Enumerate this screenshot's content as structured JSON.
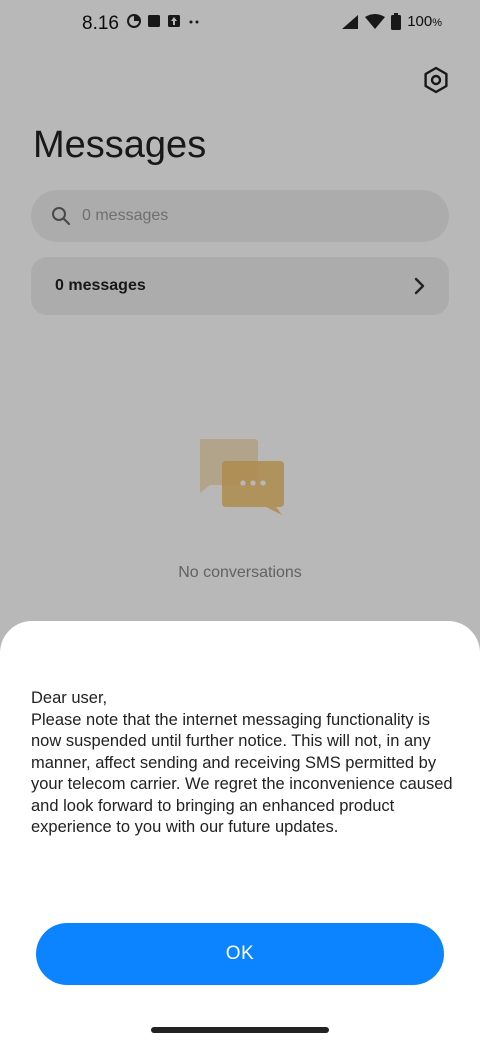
{
  "status_bar": {
    "time": "8.16",
    "battery": "100",
    "battery_unit": "%"
  },
  "app": {
    "title": "Messages",
    "search": {
      "placeholder": "0 messages"
    },
    "messages_row": {
      "label": "0 messages"
    },
    "empty_state": {
      "text": "No conversations"
    }
  },
  "dialog": {
    "message": "Dear user,\nPlease note that the internet messaging functionality is now suspended until further notice. This will not, in any manner, affect sending and receiving SMS permitted by your telecom carrier. We regret the inconvenience caused and look forward to bringing an enhanced product experience to you with our future updates.",
    "ok_label": "OK"
  },
  "colors": {
    "primary": "#0d84ff",
    "illustration": "#f2c26b"
  },
  "icons": [
    "settings-icon",
    "search-icon",
    "chevron-right-icon",
    "chat-bubbles-icon",
    "signal-icon",
    "wifi-icon",
    "battery-icon"
  ]
}
